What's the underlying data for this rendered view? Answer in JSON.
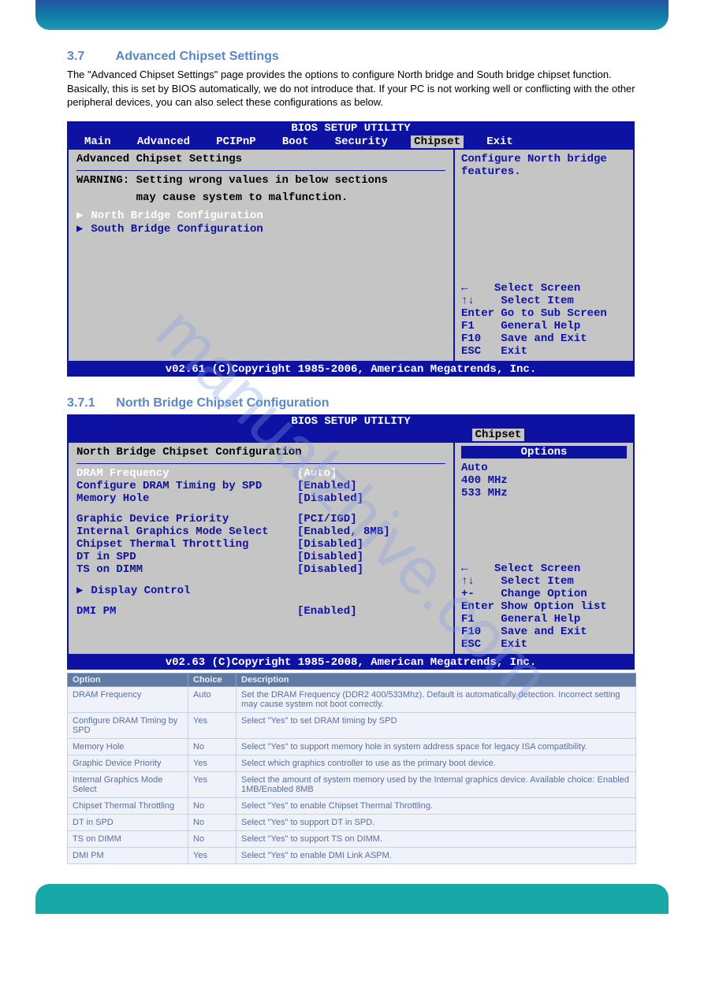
{
  "watermark": "manualzhive.com",
  "heading1": "3.7         Advanced Chipset Settings",
  "intro": "The \"Advanced Chipset Settings\" page provides the options to configure North bridge and South bridge chipset function. Basically, this is set by BIOS automatically, we do not introduce that. If your PC is not working well or conflicting with the other peripheral devices, you can also select these configurations as below.",
  "bios1": {
    "title": "BIOS SETUP UTILITY",
    "menu": [
      "Main",
      "Advanced",
      "PCIPnP",
      "Boot",
      "Security",
      "Chipset",
      "Exit"
    ],
    "selected_menu": 5,
    "panel_title": "Advanced Chipset Settings",
    "warning1": "WARNING: Setting wrong values in below sections",
    "warning2": "         may cause system to malfunction.",
    "items": [
      "North Bridge Configuration",
      "South Bridge Configuration"
    ],
    "selected_item": 0,
    "help": "Configure North\nbridge features.",
    "nav": [
      "←    Select Screen",
      "↑↓    Select Item",
      "Enter Go to Sub Screen",
      "F1    General Help",
      "F10   Save and Exit",
      "ESC   Exit"
    ],
    "footer": "v02.61 (C)Copyright 1985-2006, American Megatrends, Inc."
  },
  "heading2": "3.7.1      North Bridge Chipset Configuration",
  "bios2": {
    "title": "BIOS SETUP UTILITY",
    "menu_selected": "Chipset",
    "panel_title": "North Bridge Chipset Configuration",
    "options_title": "Options",
    "options_list": [
      "Auto",
      "400 MHz",
      "533 MHz"
    ],
    "nav": [
      "←    Select Screen",
      "↑↓    Select Item",
      "+-    Change Option",
      "Enter Show Option list",
      "F1    General Help",
      "F10   Save and Exit",
      "ESC   Exit"
    ],
    "footer": "v02.63 (C)Copyright 1985-2008, American Megatrends, Inc.",
    "rows": [
      {
        "label": "DRAM Frequency",
        "value": "[Auto]",
        "sel": true
      },
      {
        "label": "Configure DRAM Timing by SPD",
        "value": "[Enabled]"
      },
      {
        "label": "Memory Hole",
        "value": "[Disabled]"
      }
    ],
    "rows2": [
      {
        "label": "Graphic Device Priority",
        "value": "[PCI/IGD]"
      },
      {
        "label": "Internal Graphics Mode Select",
        "value": "[Enabled, 8MB]"
      },
      {
        "label": "Chipset Thermal Throttling",
        "value": "[Disabled]"
      },
      {
        "label": "DT in SPD",
        "value": "[Disabled]"
      },
      {
        "label": "TS on DIMM",
        "value": "[Disabled]"
      }
    ],
    "submenu": "Display Control",
    "rows3": [
      {
        "label": "DMI PM",
        "value": "[Enabled]"
      }
    ]
  },
  "table": {
    "headers": [
      "Option",
      "Choice",
      "Description"
    ],
    "rows": [
      {
        "o": "DRAM Frequency",
        "c": "Auto",
        "d": "Set the DRAM Frequency (DDR2 400/533Mhz). Default is automatically detection. Incorrect setting may cause system not boot correctly."
      },
      {
        "o": "Configure DRAM Timing by SPD",
        "c": "Yes",
        "d": "Select \"Yes\" to set DRAM timing by SPD"
      },
      {
        "o": "Memory Hole",
        "c": "No",
        "d": "Select \"Yes\" to support memory hole in system address space for legacy ISA compatibility."
      },
      {
        "o": "Graphic Device Priority",
        "c": "Yes",
        "d": "Select which graphics controller to use as the primary boot device."
      },
      {
        "o": "Internal Graphics Mode Select",
        "c": "Yes",
        "d": "Select the amount of system memory used by the Internal graphics device. Available choice: Enabled 1MB/Enabled 8MB"
      },
      {
        "o": "Chipset Thermal Throttling",
        "c": "No",
        "d": "Select \"Yes\" to enable Chipset Thermal Throttling."
      },
      {
        "o": "DT in SPD",
        "c": "No",
        "d": "Select \"Yes\" to support DT in SPD."
      },
      {
        "o": "TS on DIMM",
        "c": "No",
        "d": "Select \"Yes\" to support TS on DIMM."
      },
      {
        "o": "DMI PM",
        "c": "Yes",
        "d": "Select \"Yes\" to enable DMI Link ASPM."
      }
    ]
  }
}
